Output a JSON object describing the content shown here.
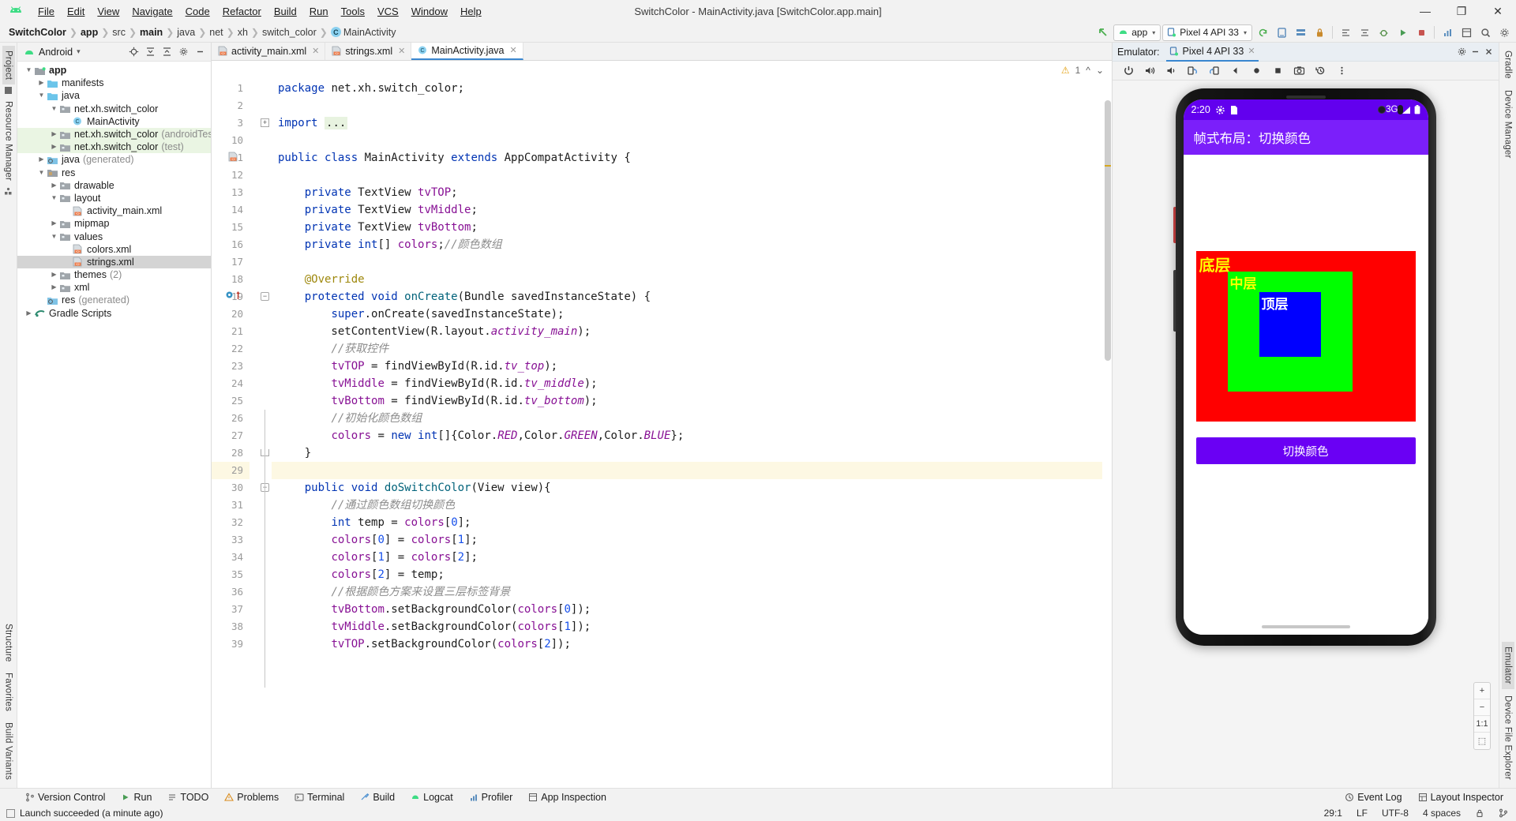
{
  "window": {
    "title": "SwitchColor - MainActivity.java [SwitchColor.app.main]",
    "minimize": "—",
    "maximize": "❐",
    "close": "✕"
  },
  "menu": {
    "items": [
      "File",
      "Edit",
      "View",
      "Navigate",
      "Code",
      "Refactor",
      "Build",
      "Run",
      "Tools",
      "VCS",
      "Window",
      "Help"
    ]
  },
  "breadcrumb": {
    "items": [
      "SwitchColor",
      "app",
      "src",
      "main",
      "java",
      "net",
      "xh",
      "switch_color"
    ],
    "class_name": "MainActivity",
    "class_badge": "C"
  },
  "toolbar": {
    "run_config": "app",
    "device": "Pixel 4 API 33",
    "caret": "▾"
  },
  "project_panel": {
    "title": "Android",
    "caret": "▾",
    "tree": [
      {
        "label": "app",
        "depth": 0,
        "arrow": "down",
        "icon": "module",
        "bold": true,
        "dim": ""
      },
      {
        "label": "manifests",
        "depth": 1,
        "arrow": "right",
        "icon": "folder",
        "bold": false,
        "dim": ""
      },
      {
        "label": "java",
        "depth": 1,
        "arrow": "down",
        "icon": "folder",
        "bold": false,
        "dim": ""
      },
      {
        "label": "net.xh.switch_color",
        "depth": 2,
        "arrow": "down",
        "icon": "pkg",
        "bold": false,
        "dim": ""
      },
      {
        "label": "MainActivity",
        "depth": 3,
        "arrow": "none",
        "icon": "class",
        "bold": false,
        "dim": ""
      },
      {
        "label": "net.xh.switch_color",
        "depth": 2,
        "arrow": "right",
        "icon": "pkg",
        "bold": false,
        "dim": "(androidTest)",
        "test": true
      },
      {
        "label": "net.xh.switch_color",
        "depth": 2,
        "arrow": "right",
        "icon": "pkg",
        "bold": false,
        "dim": "(test)",
        "test": true
      },
      {
        "label": "java",
        "depth": 1,
        "arrow": "right",
        "icon": "gen",
        "bold": false,
        "dim": "(generated)"
      },
      {
        "label": "res",
        "depth": 1,
        "arrow": "down",
        "icon": "res",
        "bold": false,
        "dim": ""
      },
      {
        "label": "drawable",
        "depth": 2,
        "arrow": "right",
        "icon": "pkg",
        "bold": false,
        "dim": ""
      },
      {
        "label": "layout",
        "depth": 2,
        "arrow": "down",
        "icon": "pkg",
        "bold": false,
        "dim": ""
      },
      {
        "label": "activity_main.xml",
        "depth": 3,
        "arrow": "none",
        "icon": "xml",
        "bold": false,
        "dim": ""
      },
      {
        "label": "mipmap",
        "depth": 2,
        "arrow": "right",
        "icon": "pkg",
        "bold": false,
        "dim": ""
      },
      {
        "label": "values",
        "depth": 2,
        "arrow": "down",
        "icon": "pkg",
        "bold": false,
        "dim": ""
      },
      {
        "label": "colors.xml",
        "depth": 3,
        "arrow": "none",
        "icon": "xml",
        "bold": false,
        "dim": ""
      },
      {
        "label": "strings.xml",
        "depth": 3,
        "arrow": "none",
        "icon": "xml",
        "bold": false,
        "dim": "",
        "selected": true
      },
      {
        "label": "themes",
        "depth": 2,
        "arrow": "right",
        "icon": "pkg",
        "bold": false,
        "dim": "(2)"
      },
      {
        "label": "xml",
        "depth": 2,
        "arrow": "right",
        "icon": "pkg",
        "bold": false,
        "dim": ""
      },
      {
        "label": "res",
        "depth": 1,
        "arrow": "none",
        "icon": "gen",
        "bold": false,
        "dim": "(generated)"
      },
      {
        "label": "Gradle Scripts",
        "depth": 0,
        "arrow": "right",
        "icon": "gradle",
        "bold": false,
        "dim": ""
      }
    ]
  },
  "left_rail": {
    "top": [
      "Project"
    ],
    "middle": [
      "Resource Manager"
    ],
    "bottom": [
      "Structure",
      "Favorites",
      "Build Variants"
    ]
  },
  "right_rail": {
    "items": [
      "Gradle",
      "Device Manager",
      "Emulator",
      "Device File Explorer"
    ]
  },
  "editor": {
    "tabs": [
      {
        "label": "activity_main.xml",
        "icon": "xml-icon",
        "active": false
      },
      {
        "label": "strings.xml",
        "icon": "xml-icon",
        "active": false
      },
      {
        "label": "MainActivity.java",
        "icon": "class-icon",
        "active": true
      }
    ],
    "warning_count": "1",
    "lines": [
      {
        "n": "1",
        "segs": [
          [
            "kw",
            "package "
          ],
          [
            "plain",
            "net.xh.switch_color;"
          ]
        ]
      },
      {
        "n": "2",
        "segs": []
      },
      {
        "n": "3",
        "segs": [
          [
            "kw",
            "import "
          ],
          [
            "impfold",
            "..."
          ]
        ],
        "fold": "plus"
      },
      {
        "n": "10",
        "segs": []
      },
      {
        "n": "11",
        "segs": [
          [
            "kw",
            "public "
          ],
          [
            "kw",
            "class "
          ],
          [
            "plain",
            "MainActivity "
          ],
          [
            "kw",
            "extends "
          ],
          [
            "plain",
            "AppCompatActivity {"
          ]
        ],
        "gutter_icon": "layout"
      },
      {
        "n": "12",
        "segs": []
      },
      {
        "n": "13",
        "segs": [
          [
            "plain",
            "    "
          ],
          [
            "kw",
            "private "
          ],
          [
            "plain",
            "TextView "
          ],
          [
            "fld",
            "tvTOP"
          ],
          [
            "plain",
            ";"
          ]
        ]
      },
      {
        "n": "14",
        "segs": [
          [
            "plain",
            "    "
          ],
          [
            "kw",
            "private "
          ],
          [
            "plain",
            "TextView "
          ],
          [
            "fld",
            "tvMiddle"
          ],
          [
            "plain",
            ";"
          ]
        ]
      },
      {
        "n": "15",
        "segs": [
          [
            "plain",
            "    "
          ],
          [
            "kw",
            "private "
          ],
          [
            "plain",
            "TextView "
          ],
          [
            "fld",
            "tvBottom"
          ],
          [
            "plain",
            ";"
          ]
        ]
      },
      {
        "n": "16",
        "segs": [
          [
            "plain",
            "    "
          ],
          [
            "kw",
            "private "
          ],
          [
            "kw",
            "int"
          ],
          [
            "plain",
            "[] "
          ],
          [
            "fld",
            "colors"
          ],
          [
            "plain",
            ";"
          ],
          [
            "cmt",
            "//颜色数组"
          ]
        ]
      },
      {
        "n": "17",
        "segs": []
      },
      {
        "n": "18",
        "segs": [
          [
            "plain",
            "    "
          ],
          [
            "ann",
            "@Override"
          ]
        ]
      },
      {
        "n": "19",
        "segs": [
          [
            "plain",
            "    "
          ],
          [
            "kw",
            "protected "
          ],
          [
            "kw",
            "void "
          ],
          [
            "meth",
            "onCreate"
          ],
          [
            "plain",
            "(Bundle savedInstanceState) {"
          ]
        ],
        "gutter_icon": "override",
        "fold": "minus"
      },
      {
        "n": "20",
        "segs": [
          [
            "plain",
            "        "
          ],
          [
            "kw",
            "super"
          ],
          [
            "plain",
            ".onCreate(savedInstanceState);"
          ]
        ]
      },
      {
        "n": "21",
        "segs": [
          [
            "plain",
            "        setContentView(R.layout."
          ],
          [
            "sfld",
            "activity_main"
          ],
          [
            "plain",
            ");"
          ]
        ]
      },
      {
        "n": "22",
        "segs": [
          [
            "plain",
            "        "
          ],
          [
            "cmt",
            "//获取控件"
          ]
        ]
      },
      {
        "n": "23",
        "segs": [
          [
            "plain",
            "        "
          ],
          [
            "fld",
            "tvTOP"
          ],
          [
            "plain",
            " = findViewById(R.id."
          ],
          [
            "sfld",
            "tv_top"
          ],
          [
            "plain",
            ");"
          ]
        ]
      },
      {
        "n": "24",
        "segs": [
          [
            "plain",
            "        "
          ],
          [
            "fld",
            "tvMiddle"
          ],
          [
            "plain",
            " = findViewById(R.id."
          ],
          [
            "sfld",
            "tv_middle"
          ],
          [
            "plain",
            ");"
          ]
        ]
      },
      {
        "n": "25",
        "segs": [
          [
            "plain",
            "        "
          ],
          [
            "fld",
            "tvBottom"
          ],
          [
            "plain",
            " = findViewById(R.id."
          ],
          [
            "sfld",
            "tv_bottom"
          ],
          [
            "plain",
            ");"
          ]
        ]
      },
      {
        "n": "26",
        "segs": [
          [
            "plain",
            "        "
          ],
          [
            "cmt",
            "//初始化颜色数组"
          ]
        ]
      },
      {
        "n": "27",
        "segs": [
          [
            "plain",
            "        "
          ],
          [
            "fld",
            "colors"
          ],
          [
            "plain",
            " = "
          ],
          [
            "kw",
            "new "
          ],
          [
            "kw",
            "int"
          ],
          [
            "plain",
            "[]{Color."
          ],
          [
            "sfld",
            "RED"
          ],
          [
            "plain",
            ",Color."
          ],
          [
            "sfld",
            "GREEN"
          ],
          [
            "plain",
            ",Color."
          ],
          [
            "sfld",
            "BLUE"
          ],
          [
            "plain",
            "};"
          ]
        ]
      },
      {
        "n": "28",
        "segs": [
          [
            "plain",
            "    }"
          ]
        ],
        "fold": "end"
      },
      {
        "n": "29",
        "segs": [],
        "current": true
      },
      {
        "n": "30",
        "segs": [
          [
            "plain",
            "    "
          ],
          [
            "kw",
            "public "
          ],
          [
            "kw",
            "void "
          ],
          [
            "meth",
            "doSwitchColor"
          ],
          [
            "plain",
            "(View view){"
          ]
        ],
        "fold": "minus"
      },
      {
        "n": "31",
        "segs": [
          [
            "plain",
            "        "
          ],
          [
            "cmt",
            "//通过颜色数组切换颜色"
          ]
        ]
      },
      {
        "n": "32",
        "segs": [
          [
            "plain",
            "        "
          ],
          [
            "kw",
            "int "
          ],
          [
            "plain",
            "temp = "
          ],
          [
            "fld",
            "colors"
          ],
          [
            "plain",
            "["
          ],
          [
            "num",
            "0"
          ],
          [
            "plain",
            "];"
          ]
        ]
      },
      {
        "n": "33",
        "segs": [
          [
            "plain",
            "        "
          ],
          [
            "fld",
            "colors"
          ],
          [
            "plain",
            "["
          ],
          [
            "num",
            "0"
          ],
          [
            "plain",
            "] = "
          ],
          [
            "fld",
            "colors"
          ],
          [
            "plain",
            "["
          ],
          [
            "num",
            "1"
          ],
          [
            "plain",
            "];"
          ]
        ]
      },
      {
        "n": "34",
        "segs": [
          [
            "plain",
            "        "
          ],
          [
            "fld",
            "colors"
          ],
          [
            "plain",
            "["
          ],
          [
            "num",
            "1"
          ],
          [
            "plain",
            "] = "
          ],
          [
            "fld",
            "colors"
          ],
          [
            "plain",
            "["
          ],
          [
            "num",
            "2"
          ],
          [
            "plain",
            "];"
          ]
        ]
      },
      {
        "n": "35",
        "segs": [
          [
            "plain",
            "        "
          ],
          [
            "fld",
            "colors"
          ],
          [
            "plain",
            "["
          ],
          [
            "num",
            "2"
          ],
          [
            "plain",
            "] = temp;"
          ]
        ]
      },
      {
        "n": "36",
        "segs": [
          [
            "plain",
            "        "
          ],
          [
            "cmt",
            "//根据颜色方案来设置三层标签背景"
          ]
        ]
      },
      {
        "n": "37",
        "segs": [
          [
            "plain",
            "        "
          ],
          [
            "fld",
            "tvBottom"
          ],
          [
            "plain",
            ".setBackgroundColor("
          ],
          [
            "fld",
            "colors"
          ],
          [
            "plain",
            "["
          ],
          [
            "num",
            "0"
          ],
          [
            "plain",
            "]);"
          ]
        ]
      },
      {
        "n": "38",
        "segs": [
          [
            "plain",
            "        "
          ],
          [
            "fld",
            "tvMiddle"
          ],
          [
            "plain",
            ".setBackgroundColor("
          ],
          [
            "fld",
            "colors"
          ],
          [
            "plain",
            "["
          ],
          [
            "num",
            "1"
          ],
          [
            "plain",
            "]);"
          ]
        ]
      },
      {
        "n": "39",
        "segs": [
          [
            "plain",
            "        "
          ],
          [
            "fld",
            "tvTOP"
          ],
          [
            "plain",
            ".setBackgroundColor("
          ],
          [
            "fld",
            "colors"
          ],
          [
            "plain",
            "["
          ],
          [
            "num",
            "2"
          ],
          [
            "plain",
            "]);"
          ]
        ]
      }
    ]
  },
  "emulator": {
    "label": "Emulator:",
    "tab": "Pixel 4 API 33",
    "phone": {
      "status_time": "2:20",
      "status_network": "3G",
      "appbar_title": "帧式布局：切换颜色",
      "layer_bottom_label": "底层",
      "layer_middle_label": "中层",
      "layer_top_label": "顶层",
      "button_label": "切换颜色",
      "colors": {
        "status_bar": "#6200ee",
        "app_bar": "#7b1ffa",
        "layer_bottom": "#ff0000",
        "layer_middle": "#00ff00",
        "layer_top": "#0000ff",
        "button": "#6a00f4",
        "label_text": "#ffff00"
      }
    },
    "zoom": {
      "plus": "+",
      "minus": "−",
      "actual": "1:1",
      "fit": "⬚"
    }
  },
  "bottom_bar": {
    "items": [
      {
        "label": "Version Control",
        "icon": "branch-icon"
      },
      {
        "label": "Run",
        "icon": "run-icon"
      },
      {
        "label": "TODO",
        "icon": "todo-icon"
      },
      {
        "label": "Problems",
        "icon": "problems-icon"
      },
      {
        "label": "Terminal",
        "icon": "terminal-icon"
      },
      {
        "label": "Build",
        "icon": "build-icon"
      },
      {
        "label": "Logcat",
        "icon": "logcat-icon"
      },
      {
        "label": "Profiler",
        "icon": "profiler-icon"
      },
      {
        "label": "App Inspection",
        "icon": "inspection-icon"
      }
    ],
    "right": [
      {
        "label": "Event Log",
        "icon": "event-log-icon"
      },
      {
        "label": "Layout Inspector",
        "icon": "layout-inspector-icon"
      }
    ]
  },
  "status_line": {
    "message": "Launch succeeded (a minute ago)",
    "caret_position": "29:1",
    "line_separator": "LF",
    "encoding": "UTF-8",
    "indent": "4 spaces"
  }
}
